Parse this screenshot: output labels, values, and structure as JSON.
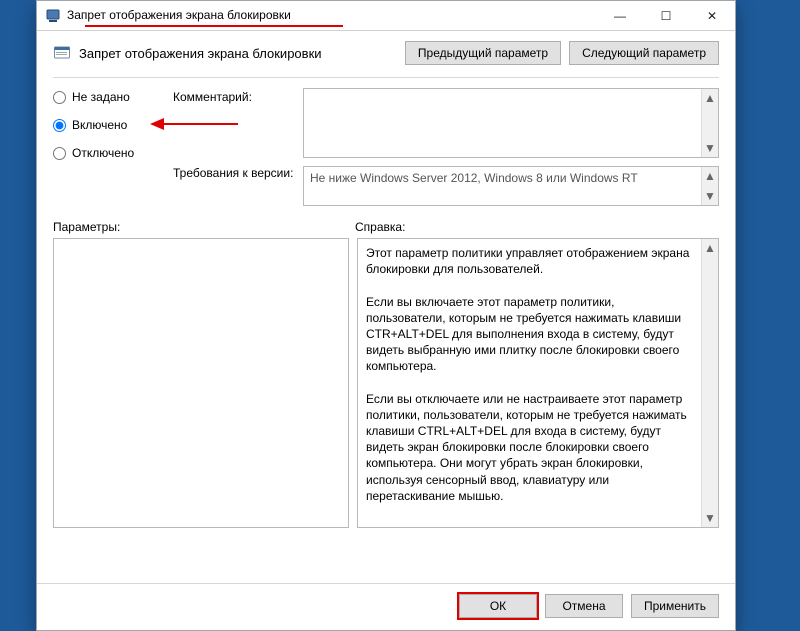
{
  "window": {
    "title": "Запрет отображения экрана блокировки",
    "policy_name": "Запрет отображения экрана блокировки",
    "minimize_glyph": "—",
    "maximize_glyph": "☐",
    "close_glyph": "✕"
  },
  "header": {
    "prev_btn": "Предыдущий параметр",
    "next_btn": "Следующий параметр"
  },
  "state": {
    "not_configured": "Не задано",
    "enabled": "Включено",
    "disabled": "Отключено",
    "selected": "enabled"
  },
  "labels": {
    "comment": "Комментарий:",
    "requirements": "Требования к версии:",
    "options": "Параметры:",
    "help": "Справка:"
  },
  "fields": {
    "comment_value": "",
    "requirements_value": "Не ниже Windows Server 2012, Windows 8 или Windows RT"
  },
  "help": {
    "p1": "Этот параметр политики управляет отображением экрана блокировки для пользователей.",
    "p2": "Если вы включаете этот параметр политики, пользователи, которым не требуется нажимать клавиши CTR+ALT+DEL для выполнения входа в систему, будут видеть выбранную ими плитку после блокировки своего компьютера.",
    "p3": "Если вы отключаете или не настраиваете этот параметр политики, пользователи, которым не требуется нажимать клавиши CTRL+ALT+DEL для входа в систему, будут видеть экран блокировки после блокировки своего компьютера. Они могут убрать экран блокировки, используя сенсорный ввод, клавиатуру или перетаскивание мышью."
  },
  "footer": {
    "ok": "ОК",
    "cancel": "Отмена",
    "apply": "Применить"
  },
  "scroll": {
    "up": "▲",
    "down": "▼"
  }
}
